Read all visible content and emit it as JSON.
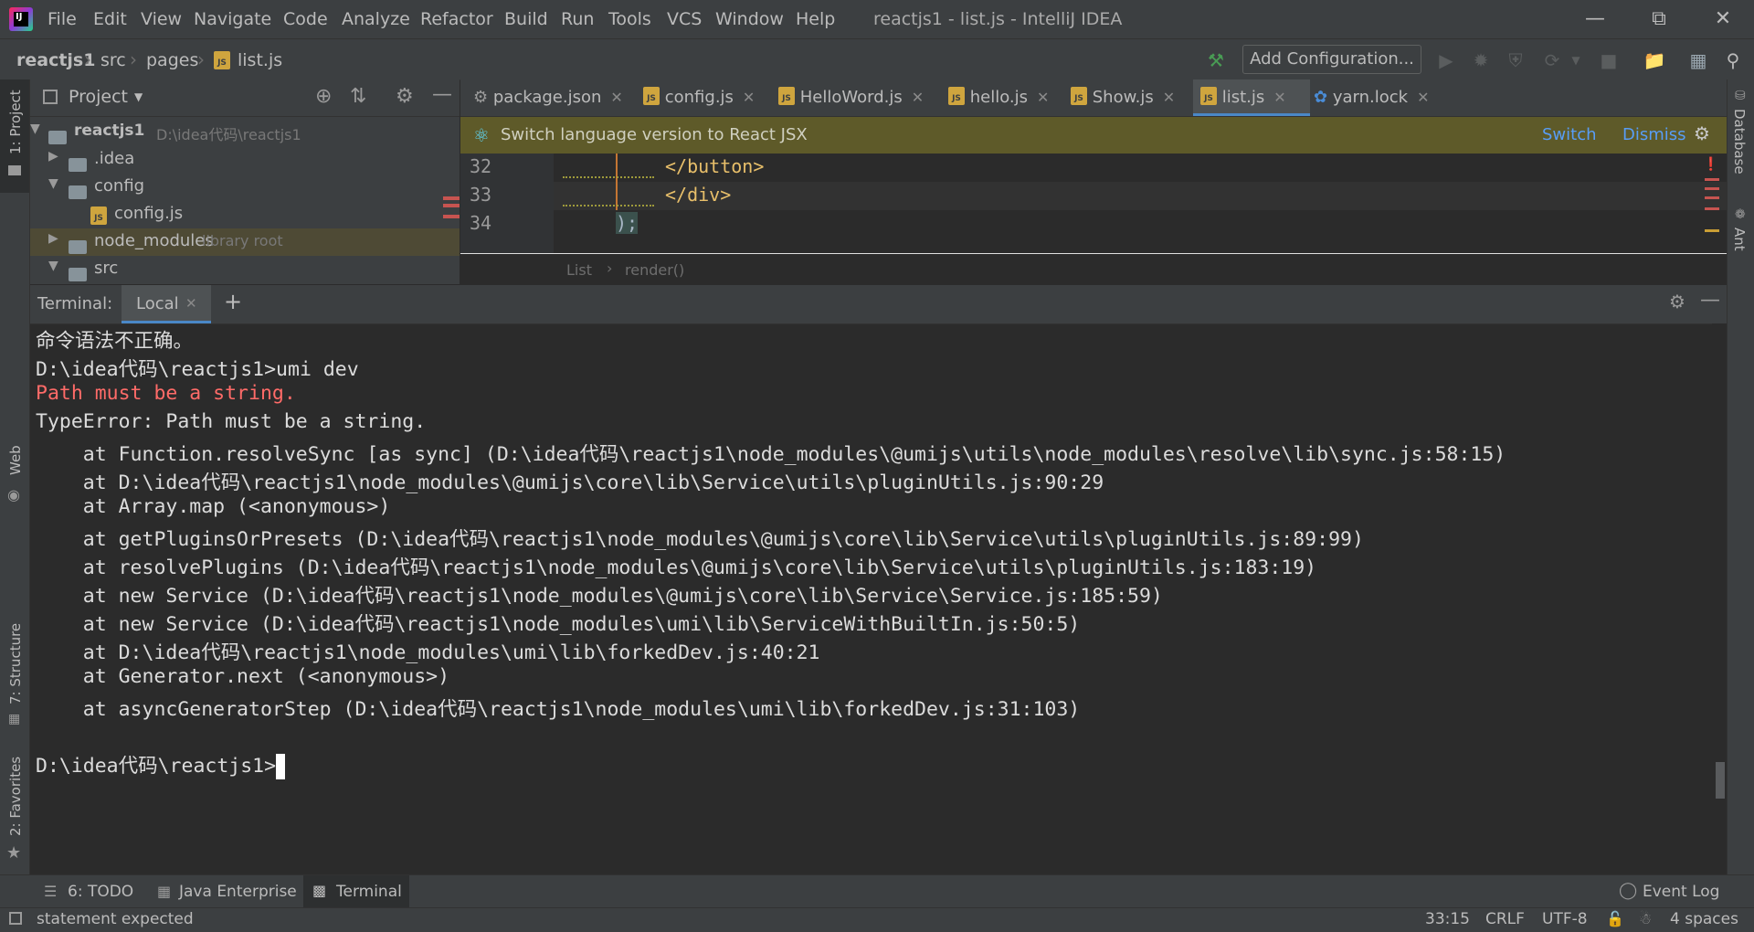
{
  "window": {
    "title": "reactjs1 - list.js - IntelliJ IDEA",
    "logo_text": "IJ"
  },
  "menu": [
    "File",
    "Edit",
    "View",
    "Navigate",
    "Code",
    "Analyze",
    "Refactor",
    "Build",
    "Run",
    "Tools",
    "VCS",
    "Window",
    "Help"
  ],
  "breadcrumb": [
    "reactjs1",
    "src",
    "pages",
    "list.js"
  ],
  "toolbar": {
    "add_configuration": "Add Configuration..."
  },
  "left_strip": {
    "project": "1: Project",
    "web": "Web",
    "structure": "7: Structure",
    "favorites": "2: Favorites"
  },
  "right_strip": {
    "database": "Database",
    "ant": "Ant"
  },
  "project_panel": {
    "title": "Project",
    "tree": [
      {
        "label": "reactjs1",
        "hint": "D:\\idea代码\\reactjs1",
        "type": "root"
      },
      {
        "label": ".idea",
        "hint": "",
        "type": "folder"
      },
      {
        "label": "config",
        "hint": "",
        "type": "folder-open"
      },
      {
        "label": "config.js",
        "hint": "",
        "type": "file"
      },
      {
        "label": "node_modules",
        "hint": "library root",
        "type": "folder"
      },
      {
        "label": "src",
        "hint": "",
        "type": "folder-open"
      }
    ]
  },
  "editor": {
    "tabs": [
      "package.json",
      "config.js",
      "HelloWord.js",
      "hello.js",
      "Show.js",
      "list.js",
      "yarn.lock"
    ],
    "active_tab": "list.js",
    "banner": {
      "text": "Switch language version to React JSX",
      "switch": "Switch",
      "dismiss": "Dismiss"
    },
    "lines": [
      {
        "num": "32",
        "code": "</button>"
      },
      {
        "num": "33",
        "code": "</div>"
      },
      {
        "num": "34",
        "code": ");"
      }
    ],
    "crumbs": [
      "List",
      "render()"
    ]
  },
  "terminal": {
    "label": "Terminal:",
    "tab": "Local",
    "lines": [
      {
        "text": "命令语法不正确。",
        "type": "normal"
      },
      {
        "text": "D:\\idea代码\\reactjs1>umi dev",
        "type": "normal"
      },
      {
        "text": "Path must be a string.",
        "type": "error"
      },
      {
        "text": "TypeError: Path must be a string.",
        "type": "normal"
      },
      {
        "text": "    at Function.resolveSync [as sync] (D:\\idea代码\\reactjs1\\node_modules\\@umijs\\utils\\node_modules\\resolve\\lib\\sync.js:58:15)",
        "type": "normal"
      },
      {
        "text": "    at D:\\idea代码\\reactjs1\\node_modules\\@umijs\\core\\lib\\Service\\utils\\pluginUtils.js:90:29",
        "type": "normal"
      },
      {
        "text": "    at Array.map (<anonymous>)",
        "type": "normal"
      },
      {
        "text": "    at getPluginsOrPresets (D:\\idea代码\\reactjs1\\node_modules\\@umijs\\core\\lib\\Service\\utils\\pluginUtils.js:89:99)",
        "type": "normal"
      },
      {
        "text": "    at resolvePlugins (D:\\idea代码\\reactjs1\\node_modules\\@umijs\\core\\lib\\Service\\utils\\pluginUtils.js:183:19)",
        "type": "normal"
      },
      {
        "text": "    at new Service (D:\\idea代码\\reactjs1\\node_modules\\@umijs\\core\\lib\\Service\\Service.js:185:59)",
        "type": "normal"
      },
      {
        "text": "    at new Service (D:\\idea代码\\reactjs1\\node_modules\\umi\\lib\\ServiceWithBuiltIn.js:50:5)",
        "type": "normal"
      },
      {
        "text": "    at D:\\idea代码\\reactjs1\\node_modules\\umi\\lib\\forkedDev.js:40:21",
        "type": "normal"
      },
      {
        "text": "    at Generator.next (<anonymous>)",
        "type": "normal"
      },
      {
        "text": "    at asyncGeneratorStep (D:\\idea代码\\reactjs1\\node_modules\\umi\\lib\\forkedDev.js:31:103)",
        "type": "normal"
      },
      {
        "text": "",
        "type": "normal"
      },
      {
        "text": "D:\\idea代码\\reactjs1>",
        "type": "prompt"
      }
    ]
  },
  "bottom_tools": {
    "todo": "6: TODO",
    "java_enterprise": "Java Enterprise",
    "terminal": "Terminal",
    "event_log": "Event Log"
  },
  "status": {
    "message": "statement expected",
    "position": "33:15",
    "line_sep": "CRLF",
    "encoding": "UTF-8",
    "indent": "4 spaces"
  }
}
